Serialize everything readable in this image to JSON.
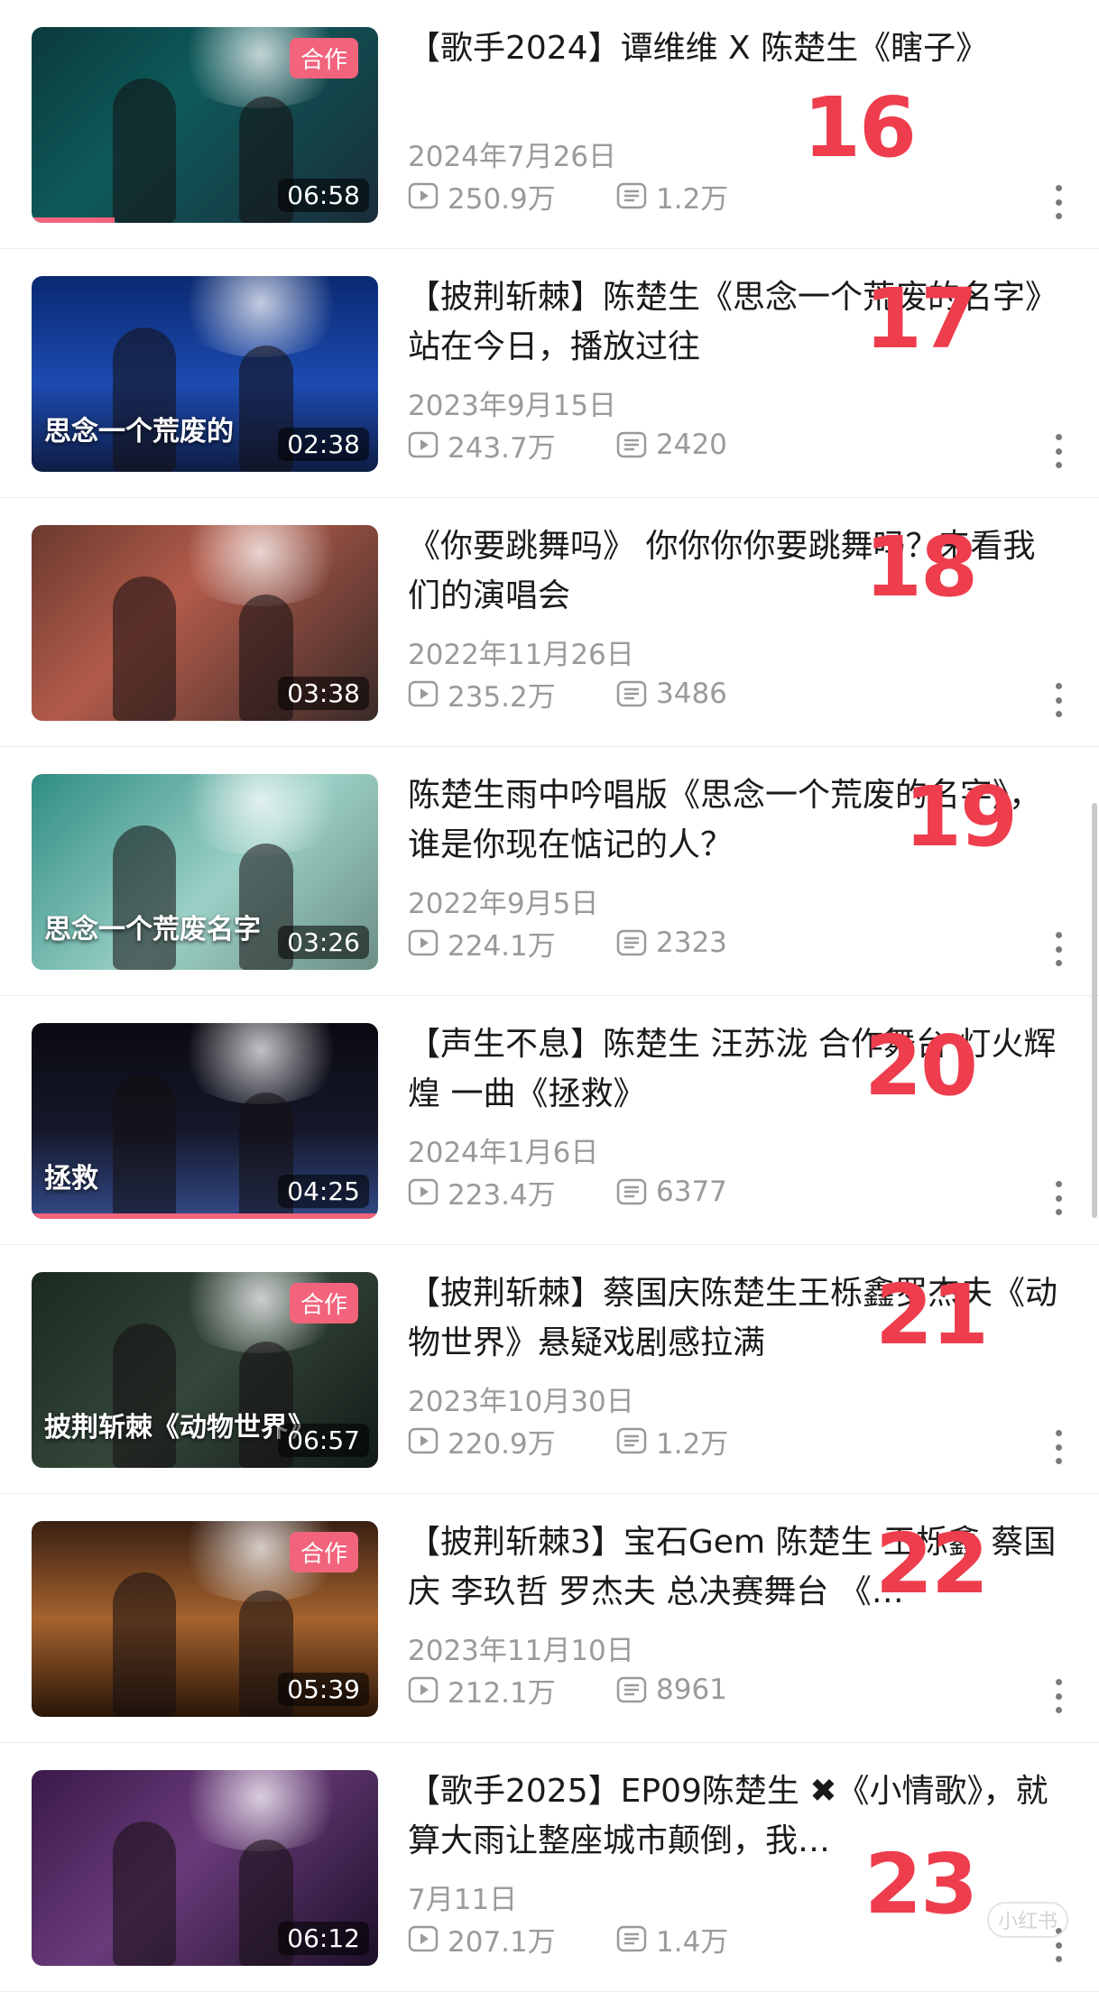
{
  "videos": [
    {
      "title": "【歌手2024】谭维维 X 陈楚生《瞎子》",
      "date": "2024年7月26日",
      "views": "250.9万",
      "comments": "1.2万",
      "duration": "06:58",
      "badge": "合作",
      "rank": "16",
      "overlay": ""
    },
    {
      "title": "【披荆斩棘】陈楚生《思念一个荒废的名字》站在今日，播放过往",
      "date": "2023年9月15日",
      "views": "243.7万",
      "comments": "2420",
      "duration": "02:38",
      "badge": "",
      "rank": "17",
      "overlay": "思念一个荒废的"
    },
    {
      "title": "《你要跳舞吗》 你你你你要跳舞吗？来看我们的演唱会",
      "date": "2022年11月26日",
      "views": "235.2万",
      "comments": "3486",
      "duration": "03:38",
      "badge": "",
      "rank": "18",
      "overlay": ""
    },
    {
      "title": "陈楚生雨中吟唱版《思念一个荒废的名字》，谁是你现在惦记的人？",
      "date": "2022年9月5日",
      "views": "224.1万",
      "comments": "2323",
      "duration": "03:26",
      "badge": "",
      "rank": "19",
      "overlay": "思念一个荒废名字"
    },
    {
      "title": "【声生不息】陈楚生 汪苏泷 合作舞台 灯火辉煌 一曲《拯救》",
      "date": "2024年1月6日",
      "views": "223.4万",
      "comments": "6377",
      "duration": "04:25",
      "badge": "",
      "rank": "20",
      "overlay": "拯救"
    },
    {
      "title": "【披荆斩棘】蔡国庆陈楚生王栎鑫罗杰夫《动物世界》悬疑戏剧感拉满",
      "date": "2023年10月30日",
      "views": "220.9万",
      "comments": "1.2万",
      "duration": "06:57",
      "badge": "合作",
      "rank": "21",
      "overlay": "披荆斩棘《动物世界》"
    },
    {
      "title": "【披荆斩棘3】宝石Gem 陈楚生 王栎鑫 蔡国庆 李玖哲 罗杰夫 总决赛舞台 《…",
      "date": "2023年11月10日",
      "views": "212.1万",
      "comments": "8961",
      "duration": "05:39",
      "badge": "合作",
      "rank": "22",
      "overlay": ""
    },
    {
      "title": "【歌手2025】EP09陈楚生 ✖《小情歌》，就算大雨让整座城市颠倒，我…",
      "date": "7月11日",
      "views": "207.1万",
      "comments": "1.4万",
      "duration": "06:12",
      "badge": "",
      "rank": "23",
      "overlay": ""
    }
  ],
  "icons": {
    "views": "play-icon",
    "comments": "comment-icon",
    "more": "more-vertical-icon"
  },
  "colors": {
    "accent": "#f2637c",
    "rank": "#ee3d4d",
    "meta": "#9a9a9a"
  },
  "watermark": "小红书"
}
